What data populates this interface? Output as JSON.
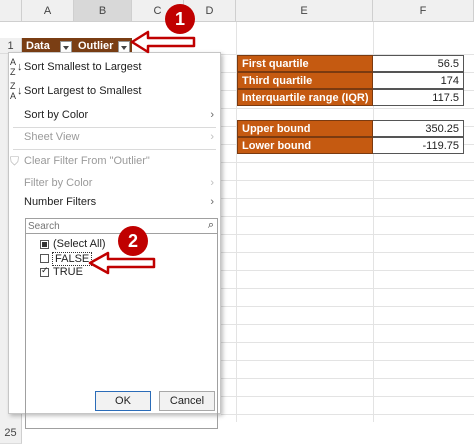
{
  "columns": [
    "A",
    "B",
    "C",
    "D",
    "E",
    "F"
  ],
  "rows": {
    "first": "1",
    "last": "25"
  },
  "table_headers": {
    "data": "Data",
    "outlier": "Outlier"
  },
  "stats": [
    {
      "label": "First quartile",
      "value": "56.5"
    },
    {
      "label": "Third quartile",
      "value": "174"
    },
    {
      "label": "Interquartile range (IQR)",
      "value": "117.5"
    },
    {
      "label": "Upper bound",
      "value": "350.25"
    },
    {
      "label": "Lower bound",
      "value": "-119.75"
    }
  ],
  "menu": {
    "sort_asc": "Sort Smallest to Largest",
    "sort_desc": "Sort Largest to Smallest",
    "sort_color": "Sort by Color",
    "sheet_view": "Sheet View",
    "clear_filter": "Clear Filter From \"Outlier\"",
    "filter_color": "Filter by Color",
    "number_filters": "Number Filters",
    "search_placeholder": "Search",
    "list": [
      "(Select All)",
      "FALSE",
      "TRUE"
    ],
    "ok": "OK",
    "cancel": "Cancel"
  },
  "callouts": [
    "1",
    "2"
  ],
  "colors": {
    "header_brown": "#7a3e14",
    "stat_orange": "#c55a11",
    "callout_red": "#c00000"
  },
  "icons": [
    "sort-ascending-icon",
    "sort-descending-icon",
    "clear-filter-icon",
    "search-icon",
    "dropdown-arrow-icon",
    "pointer-arrow-icon"
  ]
}
